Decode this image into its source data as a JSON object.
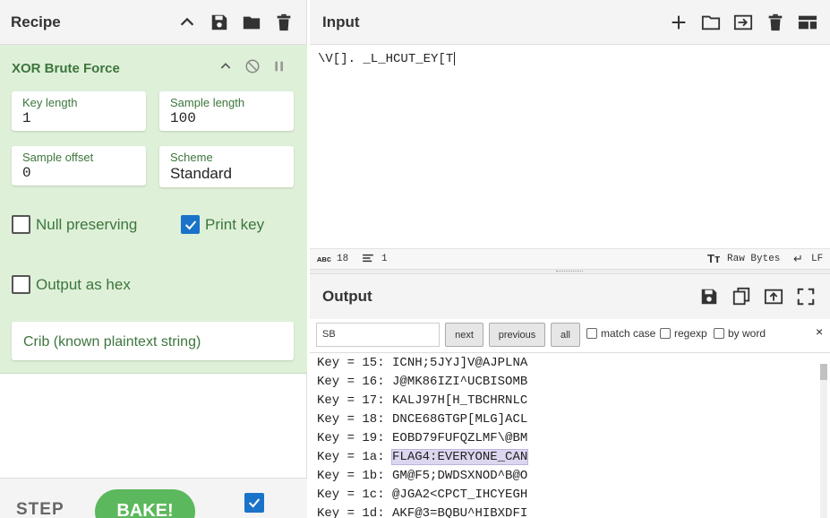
{
  "recipe": {
    "title": "Recipe",
    "operation": {
      "name": "XOR Brute Force",
      "fields": {
        "key_length": {
          "label": "Key length",
          "value": "1"
        },
        "sample_length": {
          "label": "Sample length",
          "value": "100"
        },
        "sample_offset": {
          "label": "Sample offset",
          "value": "0"
        },
        "scheme": {
          "label": "Scheme",
          "value": "Standard"
        }
      },
      "checkboxes": {
        "null_preserving": {
          "label": "Null preserving",
          "checked": false
        },
        "print_key": {
          "label": "Print key",
          "checked": true
        },
        "output_as_hex": {
          "label": "Output as hex",
          "checked": false
        }
      },
      "crib": {
        "placeholder": "Crib (known plaintext string)"
      }
    },
    "controls": {
      "step": "STEP",
      "bake": "BAKE!",
      "auto_bake_checked": true
    }
  },
  "input": {
    "title": "Input",
    "text": "\\V[]. _L_HCUT_EY[T",
    "status": {
      "length": "18",
      "lines": "1",
      "format": "Raw Bytes",
      "eol": "LF"
    }
  },
  "output": {
    "title": "Output",
    "search": {
      "value": "SB",
      "next": "next",
      "previous": "previous",
      "all": "all",
      "match_case": "match case",
      "regexp": "regexp",
      "by_word": "by word",
      "close": "×"
    },
    "lines": [
      {
        "key": "Key = 15:",
        "text": "ICNH;5JYJ]V@AJPLNA",
        "highlight": false
      },
      {
        "key": "Key = 16:",
        "text": "J@MK86IZI^UCBISOMB",
        "highlight": false
      },
      {
        "key": "Key = 17:",
        "text": "KALJ97H[H_TBCHRNLC",
        "highlight": false
      },
      {
        "key": "Key = 18:",
        "text": "DNCE68GTGP[MLG]ACL",
        "highlight": false
      },
      {
        "key": "Key = 19:",
        "text": "EOBD79FUFQZLMF\\@BM",
        "highlight": false
      },
      {
        "key": "Key = 1a:",
        "text": "FLAG4:EVERYONE_CAN",
        "highlight": true
      },
      {
        "key": "Key = 1b:",
        "text": "GM@F5;DWDSXNOD^B@O",
        "highlight": false
      },
      {
        "key": "Key = 1c:",
        "text": "@JGA2<CPCT_IHCYEGH",
        "highlight": false
      },
      {
        "key": "Key = 1d:",
        "text": "AKF@3=BQBU^HIBXDFI",
        "highlight": false
      }
    ]
  },
  "colors": {
    "accent_blue": "#1a73c8",
    "op_bg": "#dff0d8",
    "op_text": "#3c763d",
    "bake_green": "#5cb85c"
  }
}
